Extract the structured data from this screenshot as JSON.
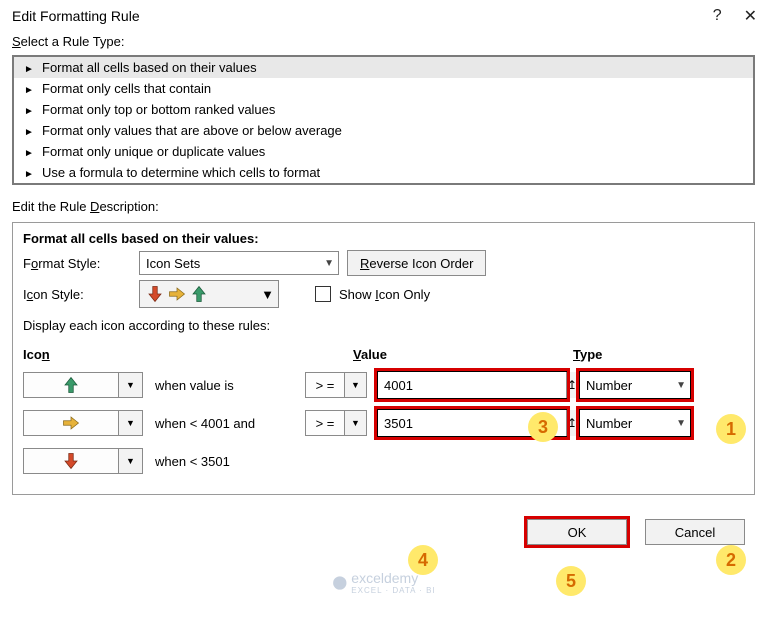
{
  "title": "Edit Formatting Rule",
  "section_select_rule": "Select a Rule Type:",
  "rule_types": [
    "Format all cells based on their values",
    "Format only cells that contain",
    "Format only top or bottom ranked values",
    "Format only values that are above or below average",
    "Format only unique or duplicate values",
    "Use a formula to determine which cells to format"
  ],
  "section_edit_desc": "Edit the Rule Description:",
  "desc_heading": "Format all cells based on their values:",
  "format_style_label": "Format Style:",
  "format_style_value": "Icon Sets",
  "reverse_btn": "Reverse Icon Order",
  "icon_style_label": "Icon Style:",
  "show_icon_only": "Show Icon Only",
  "rules_intro": "Display each icon according to these rules:",
  "col_icon": "Icon",
  "col_value": "Value",
  "col_type": "Type",
  "rows": [
    {
      "when": "when value is",
      "op": "> =",
      "value": "4001",
      "type": "Number"
    },
    {
      "when": "when < 4001 and",
      "op": "> =",
      "value": "3501",
      "type": "Number"
    },
    {
      "when": "when < 3501"
    }
  ],
  "ok": "OK",
  "cancel": "Cancel",
  "callouts": {
    "c1": "1",
    "c2": "2",
    "c3": "3",
    "c4": "4",
    "c5": "5"
  },
  "watermark": {
    "brand": "exceldemy",
    "sub": "EXCEL · DATA · BI"
  }
}
